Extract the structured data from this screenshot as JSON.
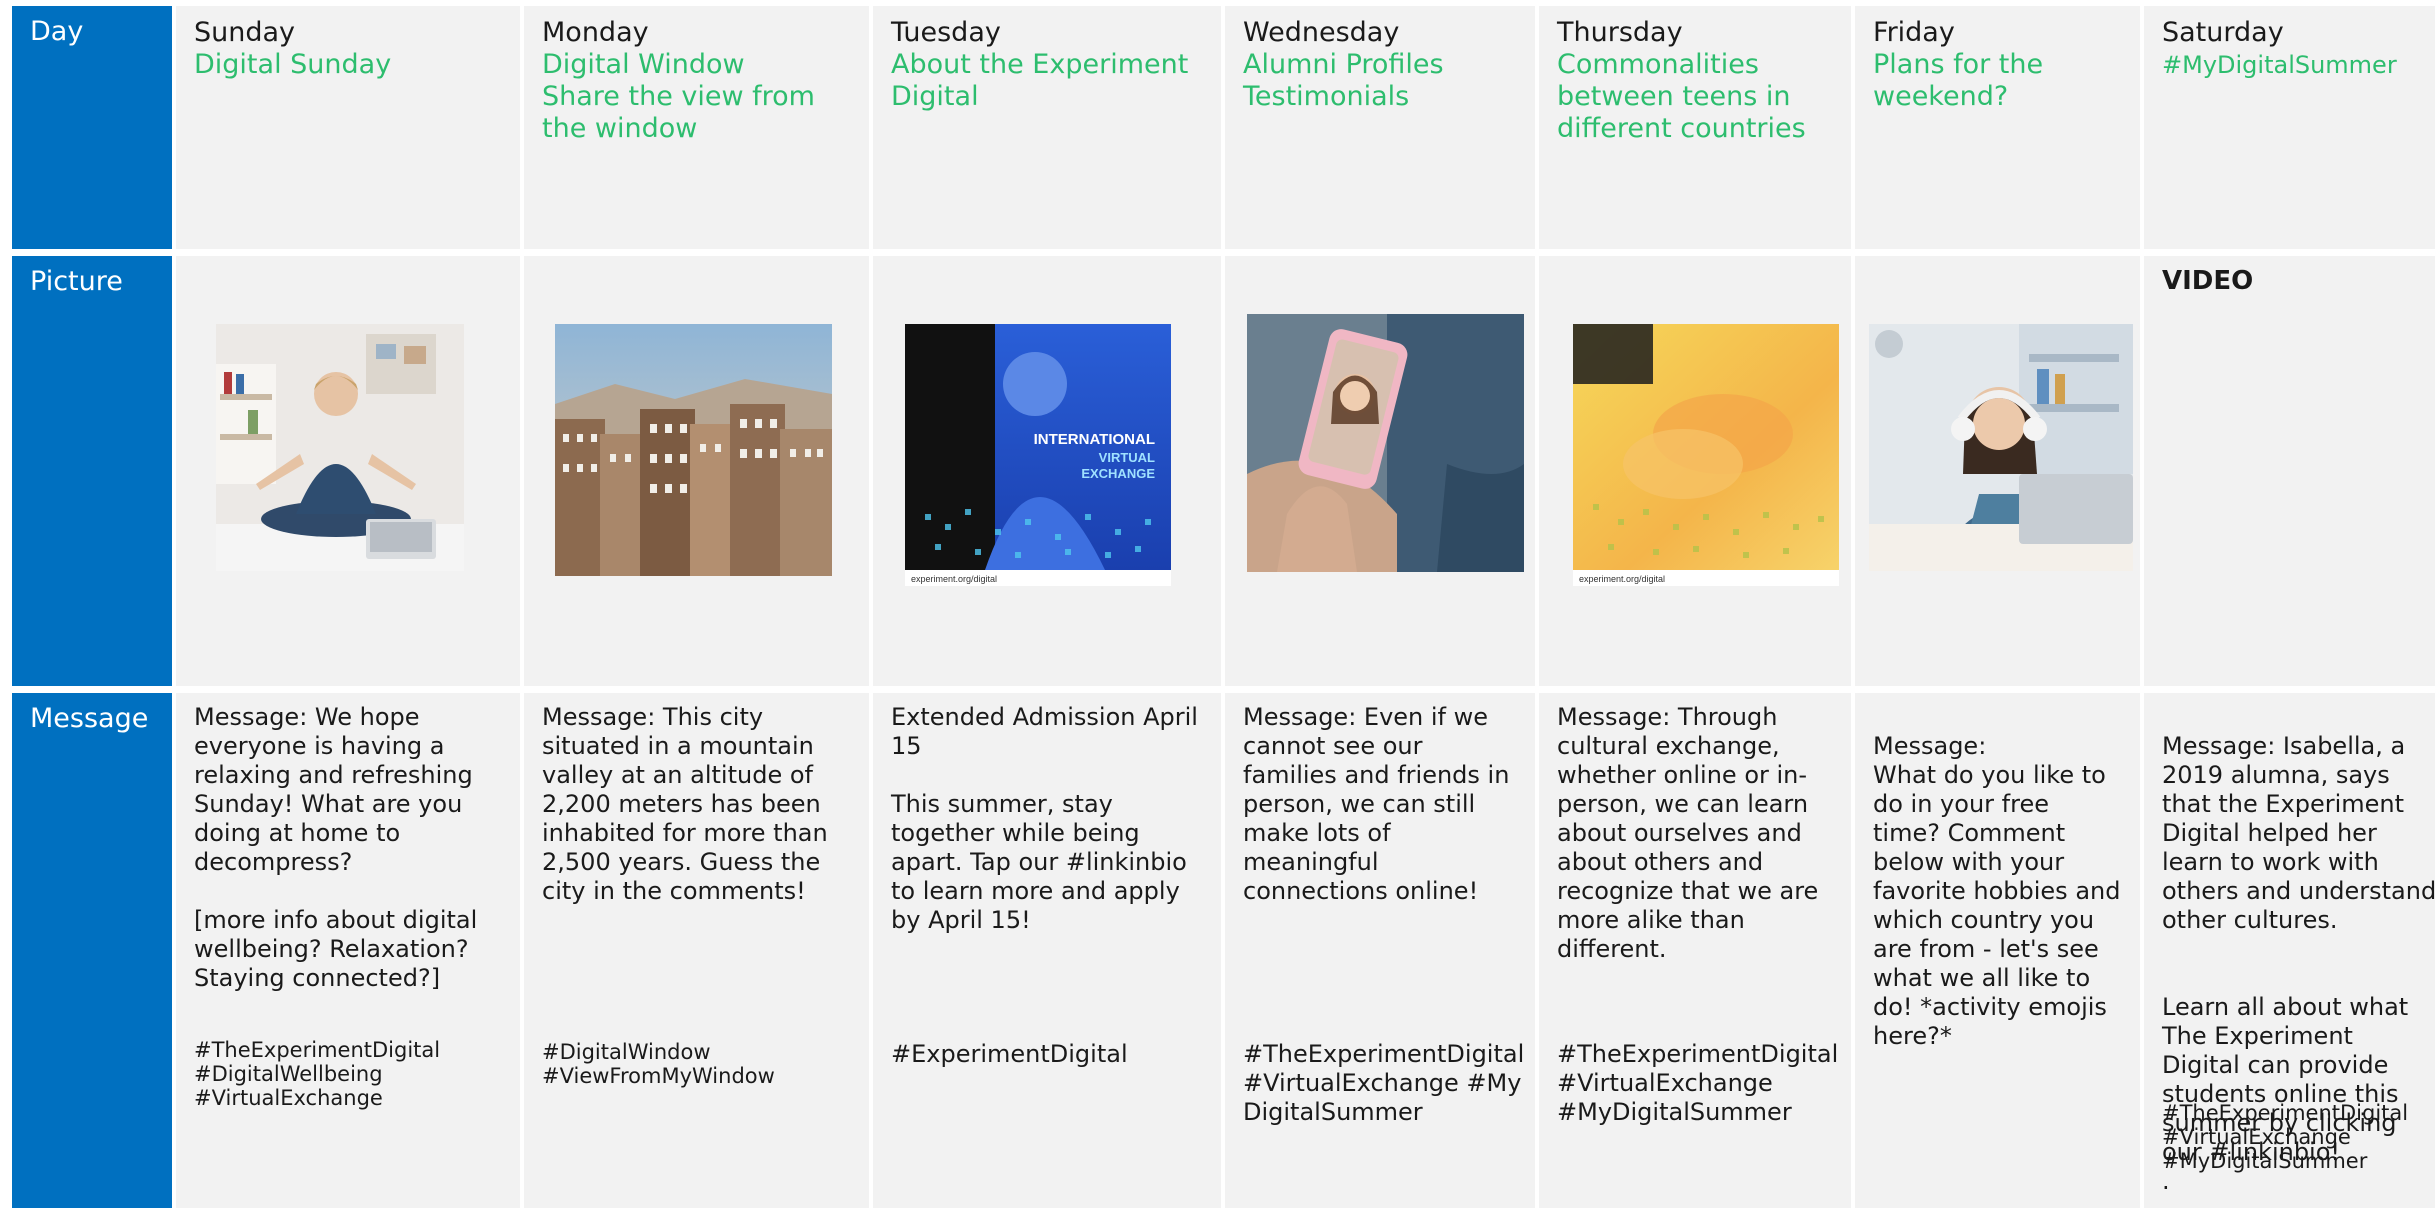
{
  "row_labels": {
    "day": "Day",
    "picture": "Picture",
    "message": "Message"
  },
  "video_label": "VIDEO",
  "days": [
    {
      "name": "Sunday",
      "topic": "Digital Sunday",
      "picture": "woman-meditating-with-laptop",
      "message": [
        "Message: We hope everyone is having a relaxing and refreshing Sunday! What are you doing at home to decompress?",
        "[more info about digital wellbeing? Relaxation? Staying connected?]"
      ],
      "hashtags": [
        "#TheExperimentDigital",
        "#DigitalWellbeing",
        "#VirtualExchange"
      ]
    },
    {
      "name": "Monday",
      "topic": "Digital Window\nShare the view from the window",
      "picture": "old-city-buildings",
      "message": [
        "Message: This city situated in a mountain valley at an altitude of 2,200 meters has been inhabited for more than 2,500 years. Guess the city in the comments!"
      ],
      "hashtags": [
        "#DigitalWindow",
        "#ViewFromMyWindow"
      ]
    },
    {
      "name": "Tuesday",
      "topic": "About the Experiment Digital",
      "picture": "international-virtual-exchange-poster",
      "poster_text": {
        "line1": "INTERNATIONAL",
        "line2": "VIRTUAL",
        "line3": "EXCHANGE",
        "footer": "experiment.org/digital"
      },
      "message": [
        "Extended Admission April 15",
        "This summer, stay together while being apart. Tap our #linkinbio to learn more and apply by April 15!"
      ],
      "hashtags": [
        "#ExperimentDigital"
      ]
    },
    {
      "name": "Wednesday",
      "topic": "Alumni Profiles\nTestimonials",
      "picture": "smartphone-video-call",
      "message": [
        "Message: Even if we cannot see our families and friends in person, we can still make lots of meaningful connections online!"
      ],
      "hashtags": [
        "#TheExperimentDigital #VirtualExchange #MyDigitalSummer"
      ]
    },
    {
      "name": "Thursday",
      "topic": "Commonalities between teens in different countries",
      "picture": "friends-yellow-poster",
      "poster_text": {
        "footer": "experiment.org/digital"
      },
      "message": [
        "Message: Through cultural exchange, whether online or in-person, we can learn about ourselves and about others and recognize that we are more alike than different."
      ],
      "hashtags": [
        "#TheExperimentDigital",
        "#VirtualExchange",
        "#MyDigitalSummer"
      ]
    },
    {
      "name": "Friday",
      "topic": "Plans for the weekend?",
      "picture": "girl-with-headphones-laptop",
      "message": [
        "Message:\nWhat do you like to do in your free time? Comment below with your favorite hobbies and which country you are from - let's see what we all like to do! *activity emojis here?*"
      ],
      "hashtags": []
    },
    {
      "name": "Saturday",
      "topic": "#MyDigitalSummer",
      "picture": "video",
      "message": [
        "Message: Isabella, a 2019 alumna, says that the Experiment Digital helped her learn to work with others and understand other cultures.",
        "Learn all about what The Experiment Digital can provide students online this summer by clicking our #linkinbio!\n."
      ],
      "hashtags": [
        "#TheExperimentDigital",
        "#VirtualExchange",
        "#MyDigitalSummer"
      ]
    }
  ]
}
